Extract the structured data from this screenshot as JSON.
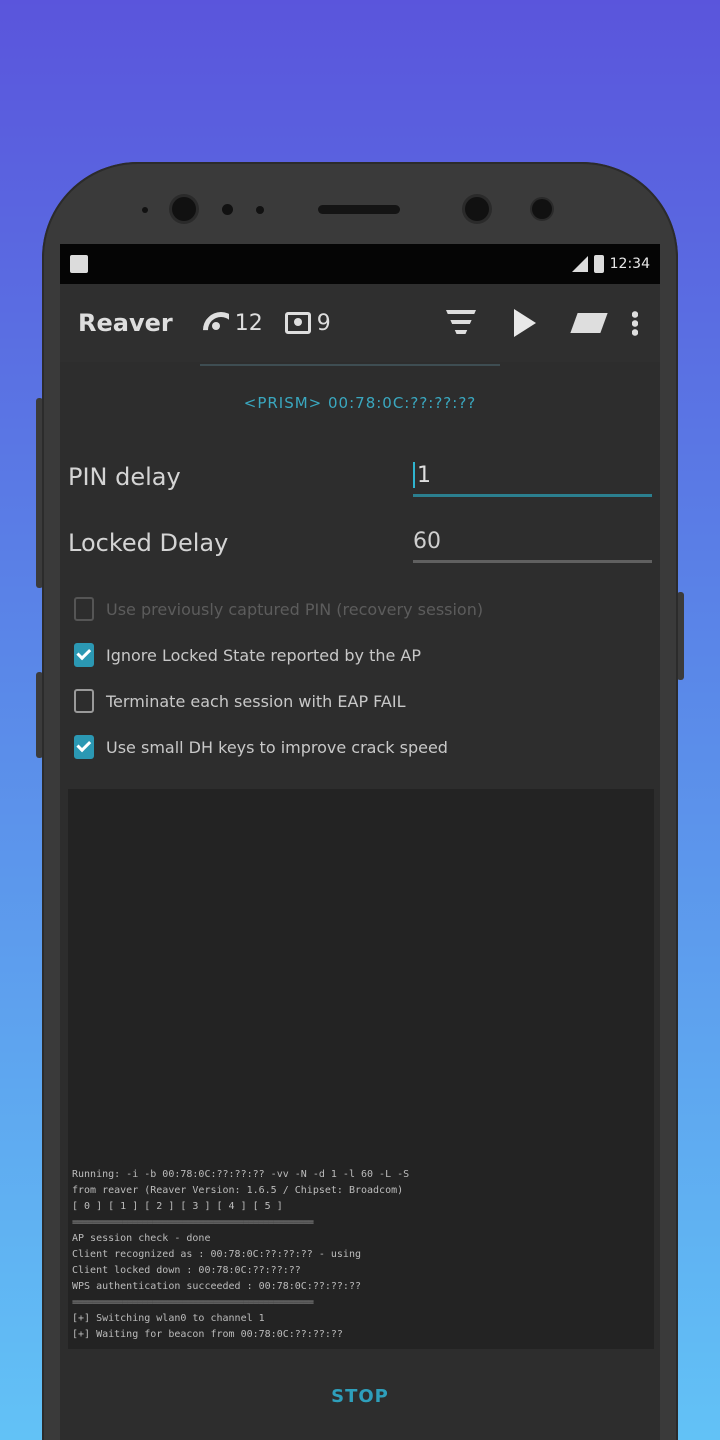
{
  "status_bar": {
    "time": "12:34"
  },
  "toolbar": {
    "title": "Reaver",
    "networks_count": "12",
    "clients_count": "9"
  },
  "target": {
    "label": "<PRISM> 00:78:0C:??:??:??"
  },
  "settings": {
    "pin_delay_label": "PIN delay",
    "pin_delay_value": "1",
    "locked_delay_label": "Locked Delay",
    "locked_delay_value": "60"
  },
  "checks": [
    {
      "label": "Use previously captured PIN (recovery session)",
      "checked": false,
      "disabled": true
    },
    {
      "label": "Ignore Locked State reported by the AP",
      "checked": true,
      "disabled": false
    },
    {
      "label": "Terminate each session with EAP FAIL",
      "checked": false,
      "disabled": false
    },
    {
      "label": "Use small DH keys to improve crack speed",
      "checked": true,
      "disabled": false
    }
  ],
  "console": {
    "lines": [
      "Running: -i -b 00:78:0C:??:??:?? -vv -N -d 1 -l 60 -L -S",
      "from reaver (Reaver Version: 1.6.5 / Chipset: Broadcom)",
      "[ 0 ] [ 1 ] [ 2 ] [ 3 ] [ 4 ] [ 5 ]",
      "================================================",
      "AP session check - done",
      "Client recognized as : 00:78:0C:??:??:?? - using",
      "Client locked down : 00:78:0C:??:??:??",
      "WPS authentication succeeded : 00:78:0C:??:??:??",
      "================================================",
      "[+] Switching wlan0 to channel 1",
      "[+] Waiting for beacon from 00:78:0C:??:??:??"
    ]
  },
  "bottom": {
    "stop_label": "STOP"
  },
  "colors": {
    "accent": "#2b98b3",
    "background_top": "#5a55dc",
    "background_bottom": "#62c2f6"
  }
}
